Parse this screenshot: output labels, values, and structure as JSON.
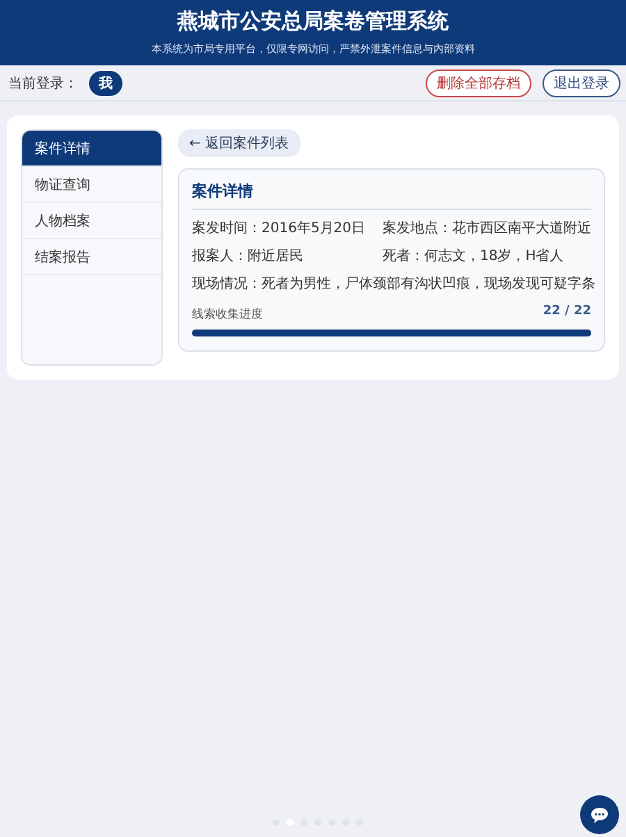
{
  "header": {
    "title": "燕城市公安总局案卷管理系统",
    "subtitle": "本系统为市局专用平台，仅限专网访问，严禁外泄案件信息与内部资料"
  },
  "user_bar": {
    "label": "当前登录：",
    "user": "我",
    "buttons": [
      {
        "label": "删除全部存档",
        "kind": "danger"
      },
      {
        "label": "退出登录",
        "kind": "normal"
      }
    ]
  },
  "sidebar": {
    "items": [
      {
        "label": "案件详情",
        "selected": true
      },
      {
        "label": "物证查询",
        "selected": false
      },
      {
        "label": "人物档案",
        "selected": false
      },
      {
        "label": "结案报告",
        "selected": false
      }
    ]
  },
  "back_button": "← 返回案件列表",
  "case": {
    "title": "案件详情",
    "fields": [
      {
        "text": "案发时间：2016年5月20日",
        "kind": "half"
      },
      {
        "text": "案发地点：花市西区南平大道附近",
        "kind": "half"
      },
      {
        "text": "报案人：附近居民",
        "kind": "half"
      },
      {
        "text": "死者：何志文，18岁，H省人",
        "kind": "half"
      },
      {
        "text": "现场情况：死者为男性，尸体颈部有沟状凹痕，现场发现可疑字条",
        "kind": "full"
      }
    ],
    "progress": {
      "label": "线索收集进度",
      "reading": "22 / 22",
      "level": 1
    }
  },
  "page_dots": [
    {
      "selected": false
    },
    {
      "selected": true
    },
    {
      "selected": false
    },
    {
      "selected": false
    },
    {
      "selected": false
    },
    {
      "selected": false
    },
    {
      "selected": false
    }
  ]
}
